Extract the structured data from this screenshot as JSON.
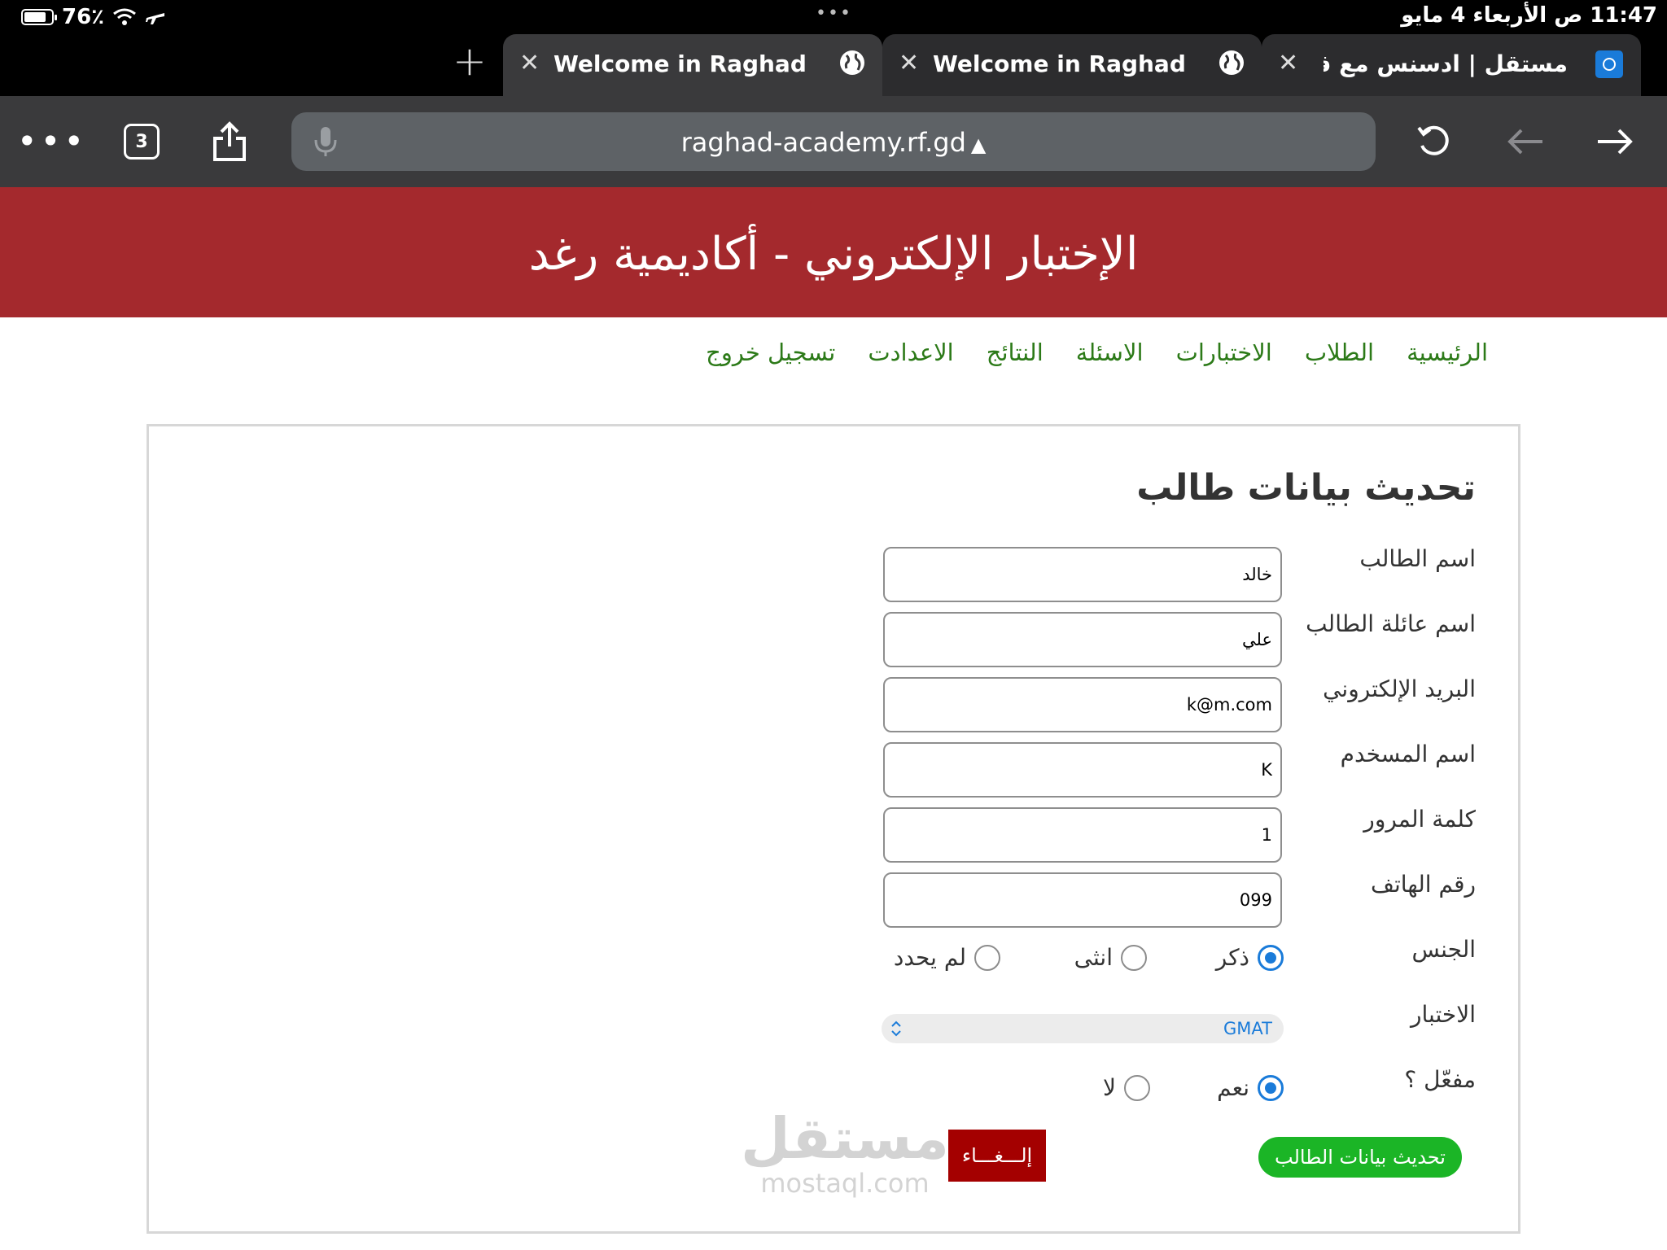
{
  "status_bar": {
    "battery": "76٪",
    "datetime": "11:47 ص الأربعاء 4 مايو"
  },
  "tabs": [
    {
      "title": "Welcome in Raghad academy"
    },
    {
      "title": "Welcome in Raghad academy"
    },
    {
      "title": "مستقل | ادسنس مع قوقل ه"
    }
  ],
  "toolbar": {
    "tab_count": "3",
    "url": "raghad-academy.rf.gd",
    "url_warning": "▲"
  },
  "site": {
    "title": "الإختبار الإلكتروني - أكاديمية رغد"
  },
  "nav": [
    "الرئيسية",
    "الطلاب",
    "الاختبارات",
    "الاسئلة",
    "النتائج",
    "الاعدادت",
    "تسجيل خروج"
  ],
  "form": {
    "heading": "تحديث بيانات طالب",
    "fields": [
      {
        "label": "اسم الطالب",
        "value": "خالد"
      },
      {
        "label": "اسم عائلة الطالب",
        "value": "علي"
      },
      {
        "label": "البريد الإلكتروني",
        "value": "k@m.com"
      },
      {
        "label": "اسم المسخدم",
        "value": "K"
      },
      {
        "label": "كلمة المرور",
        "value": "1"
      },
      {
        "label": "رقم الهاتف",
        "value": "099"
      }
    ],
    "gender": {
      "label": "الجنس",
      "options": [
        "ذكر",
        "انثى",
        "لم يحدد"
      ],
      "selected": "ذكر"
    },
    "exam": {
      "label": "الاختبار",
      "value": "GMAT"
    },
    "active": {
      "label": "مفعّل ؟",
      "options": [
        "نعم",
        "لا"
      ],
      "selected": "نعم"
    },
    "submit_label": "تحديث بيانات الطالب",
    "cancel_label": "إلـــغـــاء"
  },
  "watermark": {
    "arabic": "مستقل",
    "latin": "mostaql.com"
  },
  "colors": {
    "header_bg": "#a4292d",
    "nav_link": "#2c7a18",
    "radio_accent": "#1a7bd9",
    "submit_bg": "#1bb526",
    "cancel_bg": "#a40000"
  }
}
